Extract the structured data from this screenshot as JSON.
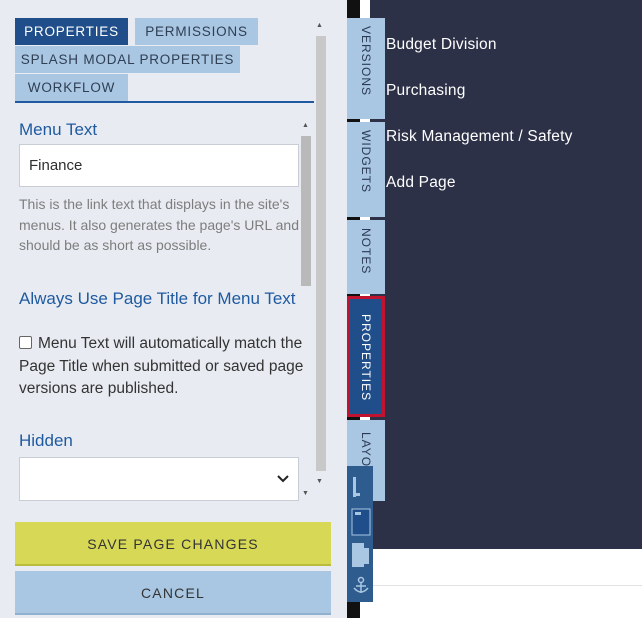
{
  "tabs": {
    "properties": "PROPERTIES",
    "permissions": "PERMISSIONS",
    "splash": "SPLASH MODAL PROPERTIES",
    "workflow": "WORKFLOW"
  },
  "form": {
    "menu_text_label": "Menu Text",
    "menu_text_value": "Finance",
    "menu_text_help": "This is the link text that displays in the site's menus. It also generates the page's URL and should be as short as possible.",
    "always_use_title_label": "Always Use Page Title for Menu Text",
    "always_use_title_checkbox_text": "Menu Text will automatically match the Page Title when submitted or saved page versions are published.",
    "hidden_label": "Hidden",
    "hidden_value": ""
  },
  "buttons": {
    "save": "SAVE PAGE CHANGES",
    "cancel": "CANCEL"
  },
  "side_tabs": {
    "versions": "VERSIONS",
    "widgets": "WIDGETS",
    "notes": "NOTES",
    "properties": "PROPERTIES",
    "layout": "LAYOUT"
  },
  "preview_menu": [
    "Budget Division",
    "Purchasing",
    "Risk Management / Safety",
    "Add Page"
  ],
  "icons": {
    "layout_left": "layout-left-icon",
    "layout_center": "layout-center-icon",
    "layout_right": "layout-right-icon",
    "anchor": "anchor-icon"
  },
  "colors": {
    "accent": "#1f4e8a",
    "tab_inactive": "#a9c6e2",
    "save_button": "#d6d856",
    "preview_background": "#2c3147",
    "highlight": "#c0132f"
  }
}
